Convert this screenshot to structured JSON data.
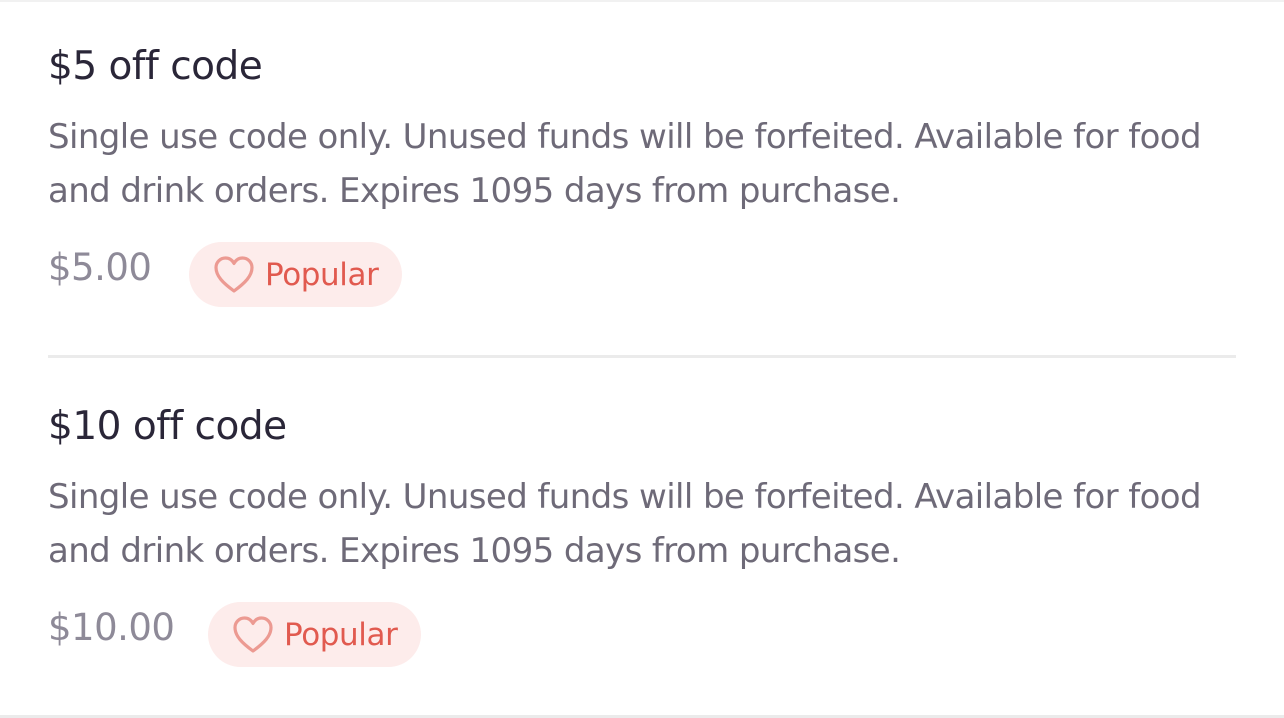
{
  "offers": [
    {
      "title": "$5 off code",
      "description": "Single use code only. Unused funds will be forfeited. Available for food and drink orders. Expires 1095 days from purchase.",
      "price": "$5.00",
      "badge": {
        "label": "Popular",
        "icon": "heart-icon"
      }
    },
    {
      "title": "$10 off code",
      "description": "Single use code only. Unused funds will be forfeited. Available for food and drink orders. Expires 1095 days from purchase.",
      "price": "$10.00",
      "badge": {
        "label": "Popular",
        "icon": "heart-icon"
      }
    }
  ],
  "colors": {
    "title": "#2a2638",
    "description": "#6e6a78",
    "price": "#8e8a98",
    "badge_bg": "#fdeceb",
    "badge_text": "#e15a4f",
    "heart": "#ec9a92",
    "divider": "#ebebeb"
  }
}
